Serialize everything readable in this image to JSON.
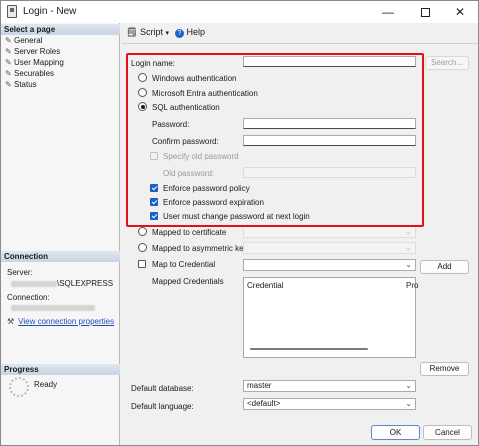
{
  "window": {
    "title": "Login - New"
  },
  "sidebar": {
    "select_page_header": "Select a page",
    "pages": [
      {
        "label": "General"
      },
      {
        "label": "Server Roles"
      },
      {
        "label": "User Mapping"
      },
      {
        "label": "Securables"
      },
      {
        "label": "Status"
      }
    ],
    "connection_header": "Connection",
    "server_label": "Server:",
    "server_value": "\\SQLEXPRESS",
    "connection_label": "Connection:",
    "view_connection_properties": "View connection properties",
    "progress_header": "Progress",
    "progress_status": "Ready"
  },
  "toolbar": {
    "script_label": "Script",
    "help_label": "Help"
  },
  "form": {
    "login_name_label": "Login name:",
    "login_name_value": "",
    "search_button": "Search...",
    "windows_auth": "Windows authentication",
    "entra_auth": "Microsoft Entra authentication",
    "sql_auth": "SQL authentication",
    "password_label": "Password:",
    "confirm_password_label": "Confirm password:",
    "specify_old_password": "Specify old password",
    "old_password_label": "Old password:",
    "enforce_policy": "Enforce password policy",
    "enforce_expiration": "Enforce password expiration",
    "must_change": "User must change password at next login",
    "mapped_cert": "Mapped to certificate",
    "mapped_asym": "Mapped to asymmetric key",
    "map_credential": "Map to Credential",
    "add_button": "Add",
    "mapped_credentials_label": "Mapped Credentials",
    "grid_col_credential": "Credential",
    "grid_col_provider": "Pro",
    "remove_button": "Remove",
    "default_database_label": "Default database:",
    "default_database_value": "master",
    "default_language_label": "Default language:",
    "default_language_value": "<default>"
  },
  "footer": {
    "ok_button": "OK",
    "cancel_button": "Cancel"
  },
  "colors": {
    "highlight_border": "#e0101c",
    "checkbox_checked": "#1b5fc4",
    "link": "#1f4fb5"
  }
}
